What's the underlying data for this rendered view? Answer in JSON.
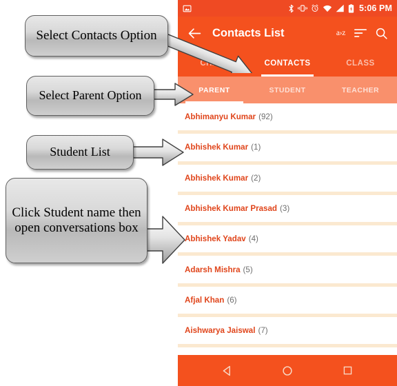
{
  "theme": {
    "primary": "#f4511e",
    "primary_dark": "#ef4a23",
    "subtab_bar": "#f9906c",
    "divider": "#fbe9d0",
    "name_text": "#e0451b",
    "count_text": "#6e6e6e",
    "callout_border": "#5e5e5e",
    "page_background": "#ffffff"
  },
  "status_bar": {
    "time": "5:06 PM",
    "icons": [
      "screenshot-icon",
      "bluetooth-icon",
      "vibrate-icon",
      "alarm-icon",
      "wifi-icon",
      "cellular-signal-icon",
      "battery-charging-icon"
    ]
  },
  "app_bar": {
    "back_icon": "back-arrow-icon",
    "title": "Contacts List",
    "sort_az_label": "a›z",
    "actions": [
      "sort-az-icon",
      "filter-icon",
      "search-icon"
    ]
  },
  "tabs": {
    "items": [
      {
        "label": "CHATS",
        "active": false
      },
      {
        "label": "CONTACTS",
        "active": true
      },
      {
        "label": "CLASS",
        "active": false
      }
    ]
  },
  "subtabs": {
    "items": [
      {
        "label": "PARENT",
        "active": true
      },
      {
        "label": "STUDENT",
        "active": false
      },
      {
        "label": "TEACHER",
        "active": false
      }
    ]
  },
  "contacts": {
    "rows": [
      {
        "name": "Abhimanyu Kumar",
        "count": "(92)"
      },
      {
        "name": "Abhishek Kumar",
        "count": "(1)"
      },
      {
        "name": "Abhishek Kumar",
        "count": "(2)"
      },
      {
        "name": "Abhishek Kumar Prasad",
        "count": "(3)"
      },
      {
        "name": "Abhishek Yadav",
        "count": "(4)"
      },
      {
        "name": "Adarsh Mishra",
        "count": "(5)"
      },
      {
        "name": "Afjal Khan",
        "count": "(6)"
      },
      {
        "name": "Aishwarya Jaiswal",
        "count": "(7)"
      }
    ]
  },
  "nav_bar": {
    "buttons": [
      "back-triangle-icon",
      "home-circle-icon",
      "recents-square-icon"
    ]
  },
  "annotations": {
    "callouts": [
      {
        "id": "contacts",
        "text": "Select Contacts Option",
        "target": "CONTACTS tab"
      },
      {
        "id": "parent",
        "text": "Select Parent Option",
        "target": "PARENT sub-tab"
      },
      {
        "id": "student",
        "text": "Student List",
        "target": "contact list"
      },
      {
        "id": "click",
        "text": "Click Student name then open conversations box",
        "target": "contact row"
      }
    ]
  }
}
